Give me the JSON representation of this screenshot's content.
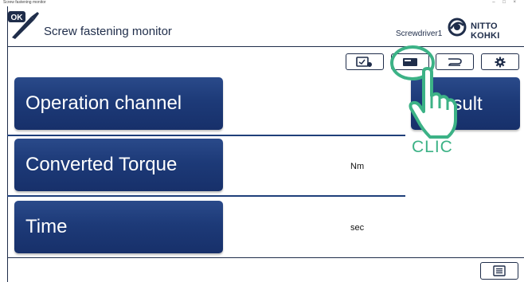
{
  "window": {
    "title": "Screw fastening monitor",
    "controls": "– □ ×"
  },
  "header": {
    "logo_text": "OK",
    "app_title": "Screw fastening monitor",
    "device": "Screwdriver1",
    "brand": "NITTO KOHKI"
  },
  "toolbar": {
    "buttons": [
      {
        "icon": "settings-monitor-icon"
      },
      {
        "icon": "display-icon"
      },
      {
        "icon": "connection-icon"
      },
      {
        "icon": "gear-icon"
      }
    ]
  },
  "panels": [
    {
      "label": "Operation channel",
      "unit": ""
    },
    {
      "label": "Converted Torque",
      "unit": "Nm"
    },
    {
      "label": "Time",
      "unit": "sec"
    }
  ],
  "result": {
    "label": "esult"
  },
  "annotation": {
    "text": "CLIC",
    "color": "#3cb286"
  },
  "footer": {
    "menu_icon": "list-icon"
  }
}
